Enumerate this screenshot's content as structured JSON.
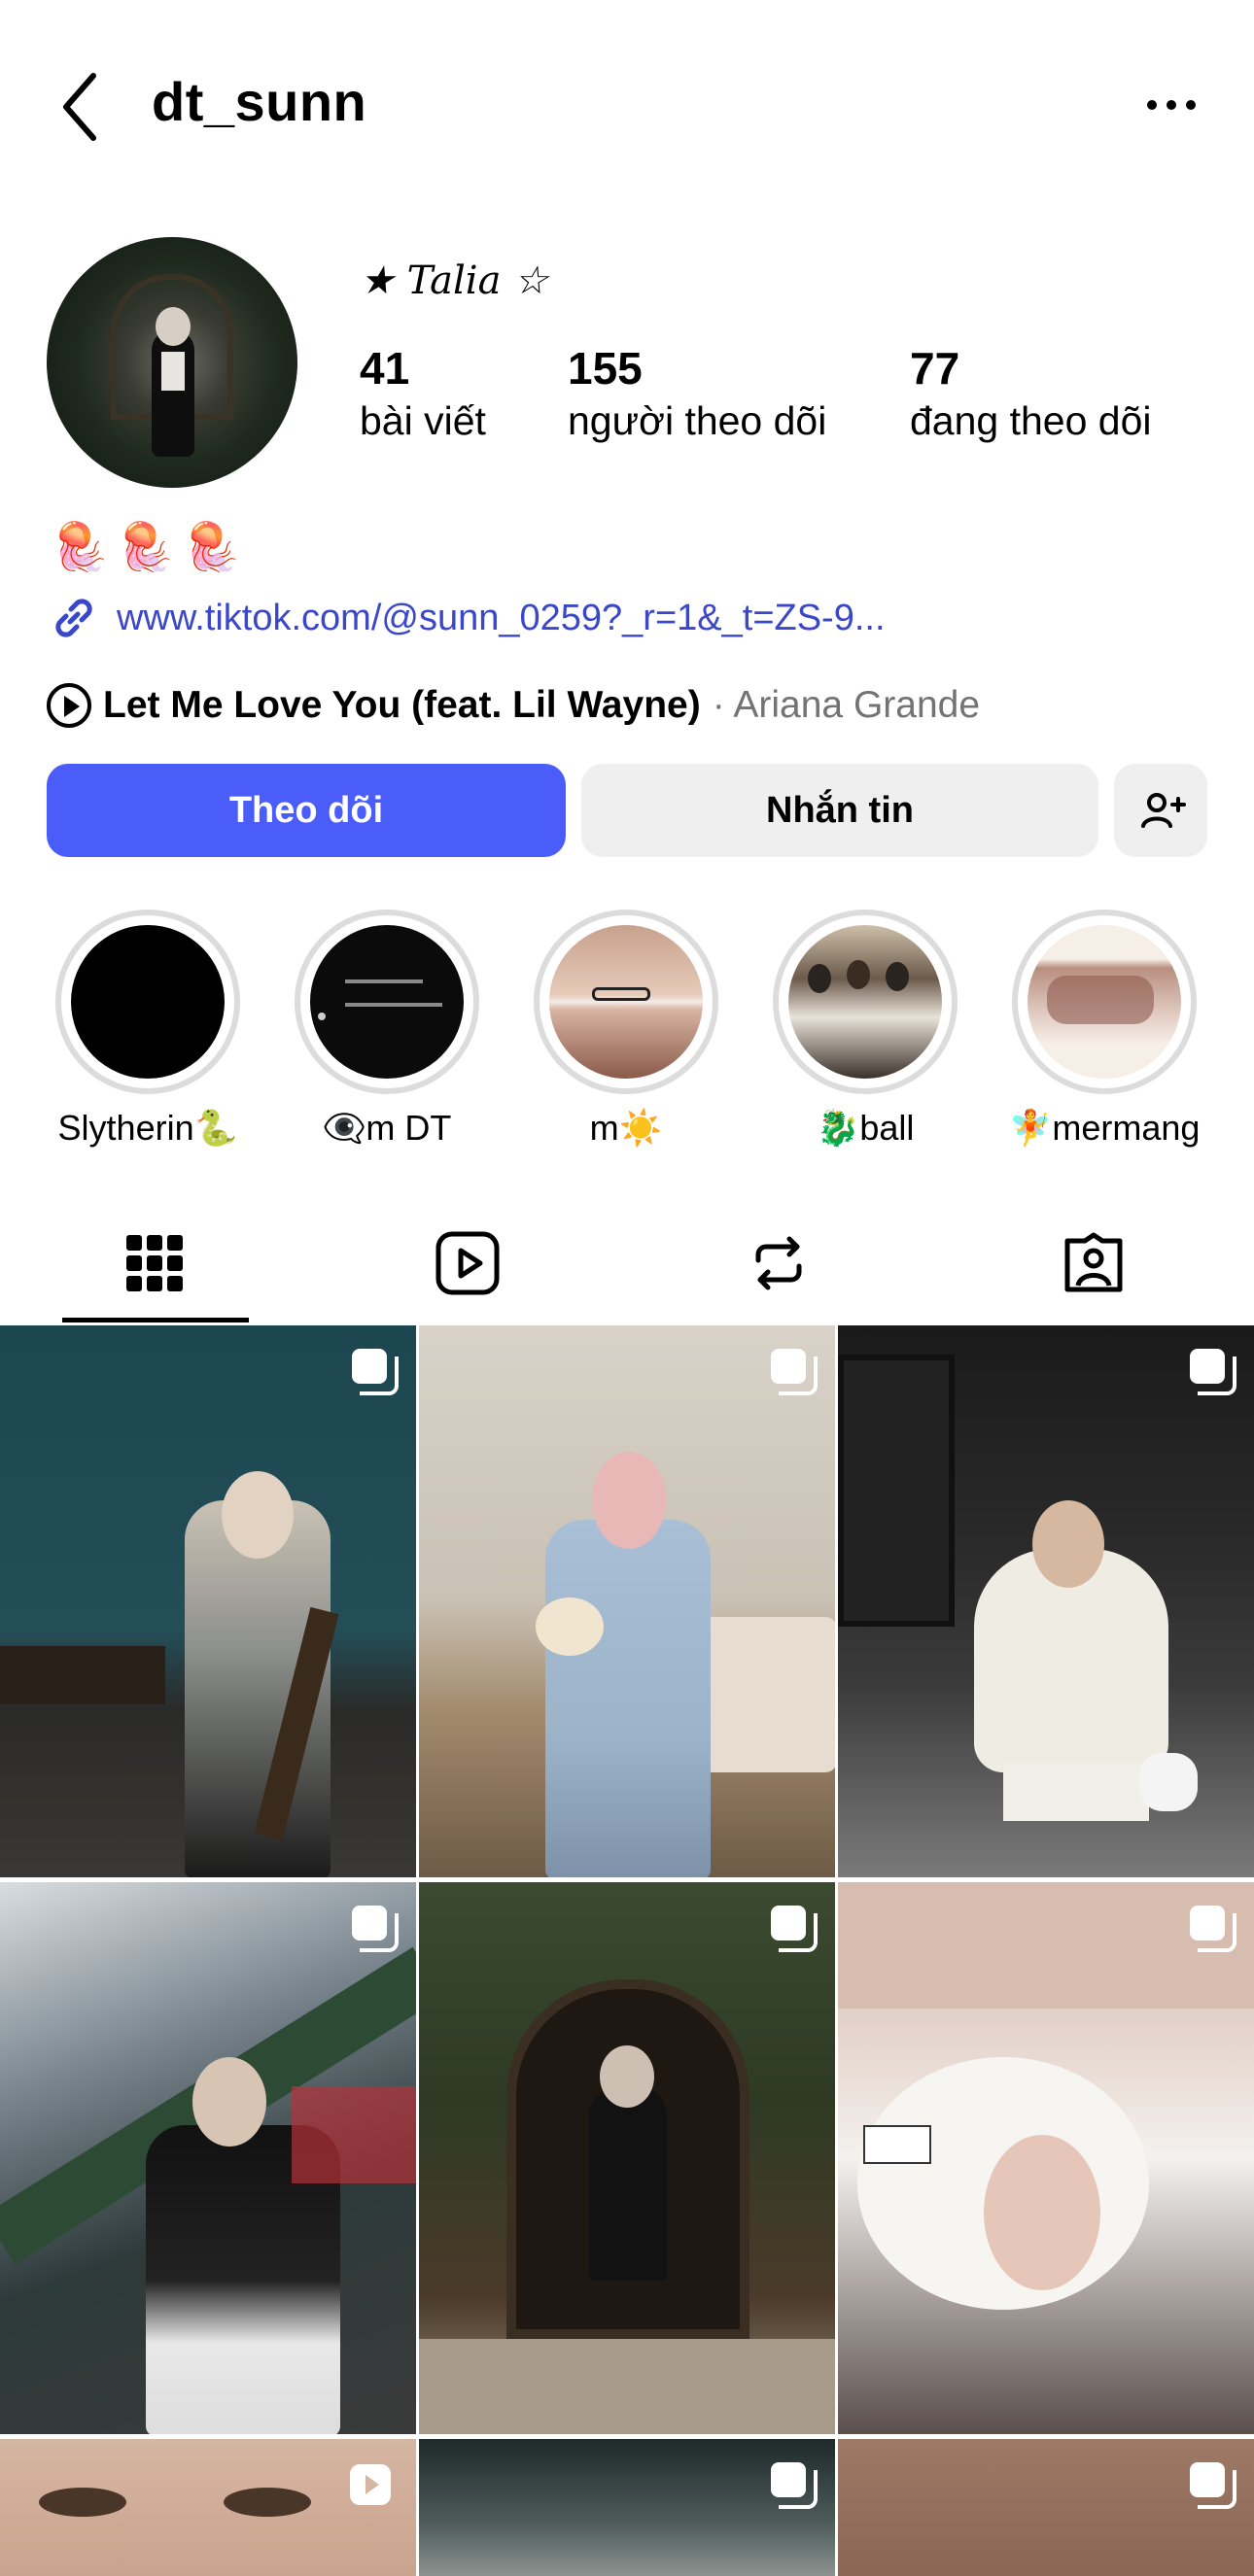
{
  "header": {
    "username": "dt_sunn",
    "back_icon": "chevron-left-icon",
    "more_icon": "ellipsis-icon"
  },
  "profile": {
    "display_name": "★ Talia ☆",
    "stats": [
      {
        "value": "41",
        "label": "bài viết"
      },
      {
        "value": "155",
        "label": "người theo dõi"
      },
      {
        "value": "77",
        "label": "đang theo dõi"
      }
    ],
    "bio_emojis": "🪼🪼🪼",
    "link": "www.tiktok.com/@sunn_0259?_r=1&_t=ZS-9...",
    "music": {
      "song": "Let Me Love You (feat. Lil Wayne)",
      "artist": "· Ariana Grande"
    }
  },
  "actions": {
    "follow": "Theo dõi",
    "message": "Nhắn tin",
    "add_user_icon": "add-person-icon"
  },
  "highlights": [
    {
      "label": "Slytherin🐍"
    },
    {
      "label": "👁‍🗨m DT"
    },
    {
      "label": "m☀️"
    },
    {
      "label": "🐉ball"
    },
    {
      "label": "🧚mermang"
    }
  ],
  "tabs": [
    {
      "name": "posts-grid",
      "icon": "grid-icon",
      "selected": true
    },
    {
      "name": "reels",
      "icon": "reels-play-icon",
      "selected": false
    },
    {
      "name": "reposts",
      "icon": "repost-icon",
      "selected": false
    },
    {
      "name": "tagged",
      "icon": "tagged-person-icon",
      "selected": false
    }
  ],
  "colors": {
    "accent": "#4a5df9",
    "link": "#3b47c9",
    "muted": "#737373",
    "button_bg": "#efefef"
  }
}
